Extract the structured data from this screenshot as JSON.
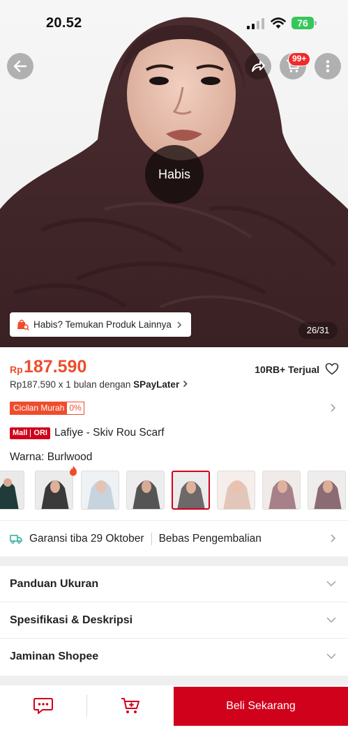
{
  "status_bar": {
    "time": "20.52",
    "battery": "76"
  },
  "header": {
    "back_icon": "arrow-left-icon",
    "share_icon": "share-icon",
    "cart_icon": "cart-icon",
    "cart_badge": "99+",
    "more_icon": "more-vertical-icon"
  },
  "hero": {
    "sold_out_label": "Habis",
    "find_similar": "Habis? Temukan Produk Lainnya",
    "image_counter": "26/31"
  },
  "product": {
    "currency": "Rp",
    "price": "187.590",
    "sold": "10RB+ Terjual",
    "installment_prefix": "Rp187.590 x 1 bulan dengan ",
    "installment_provider": "SPayLater",
    "promo_tag": "Cicilan Murah",
    "promo_rate": "0%",
    "mall_label": "Mall",
    "ori_label": "ORI",
    "title": "Lafiye - Skiv Rou Scarf",
    "variant_key": "Warna:",
    "variant_value": "Burlwood"
  },
  "shipping": {
    "guarantee": "Garansi tiba 29 Oktober",
    "returns": "Bebas Pengembalian"
  },
  "sections": [
    {
      "label": "Panduan Ukuran"
    },
    {
      "label": "Spesifikasi & Deskripsi"
    },
    {
      "label": "Jaminan Shopee"
    }
  ],
  "action_bar": {
    "chat_icon": "chat-icon",
    "add_to_cart_icon": "cart-plus-icon",
    "buy_now": "Beli Sekarang"
  },
  "colors": {
    "brand_red": "#d0011b",
    "price_orange": "#ee4d2d",
    "battery_green": "#34c759"
  }
}
